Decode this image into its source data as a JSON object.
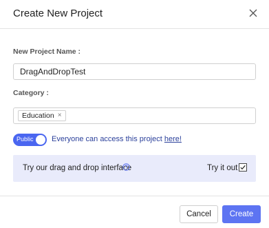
{
  "dialog": {
    "title": "Create New Project"
  },
  "form": {
    "name_label": "New Project Name :",
    "name_value": "DragAndDropTest",
    "category_label": "Category :",
    "category_tags": [
      {
        "label": "Education",
        "remove": "×"
      }
    ]
  },
  "visibility": {
    "toggle_label": "Public",
    "toggle_on": true,
    "access_text": "Everyone can access this project",
    "access_link": "here!"
  },
  "banner": {
    "text": "Try our drag and drop interface",
    "help_icon": "question-circle-icon",
    "tryit_label": "Try it out",
    "tryit_checked": true
  },
  "footer": {
    "cancel_label": "Cancel",
    "create_label": "Create"
  },
  "colors": {
    "accent": "#5d74f2",
    "toggle": "#4a66f0",
    "banner_bg": "#e9ebfb",
    "link": "#2a3f9a"
  }
}
